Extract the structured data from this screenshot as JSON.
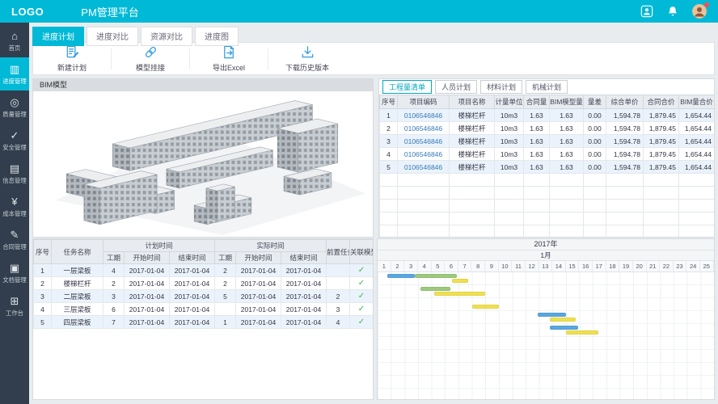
{
  "colors": {
    "accent": "#00b9d6",
    "sidebar_bg": "#323e4d",
    "bar_blue": "#5aa7e0",
    "bar_green": "#9dc97c",
    "bar_yellow": "#f0e04e",
    "check_green": "#3cb54a"
  },
  "header": {
    "logo": "LOGO",
    "title": "PM管理平台",
    "icons": [
      "contacts-icon",
      "notification-bell-icon",
      "user-avatar"
    ]
  },
  "sidebar": {
    "items": [
      {
        "label": "首页",
        "icon": "home",
        "active": false
      },
      {
        "label": "进度管理",
        "icon": "progress",
        "active": true
      },
      {
        "label": "质量管理",
        "icon": "quality",
        "active": false
      },
      {
        "label": "安全管理",
        "icon": "safety",
        "active": false
      },
      {
        "label": "信息管理",
        "icon": "info",
        "active": false
      },
      {
        "label": "成本管理",
        "icon": "cost",
        "active": false
      },
      {
        "label": "合同管理",
        "icon": "contract",
        "active": false
      },
      {
        "label": "文档管理",
        "icon": "docs",
        "active": false
      },
      {
        "label": "工作台",
        "icon": "workbench",
        "active": false
      }
    ]
  },
  "main_tabs": [
    {
      "label": "进度计划",
      "active": true
    },
    {
      "label": "进度对比",
      "active": false
    },
    {
      "label": "资源对比",
      "active": false
    },
    {
      "label": "进度图",
      "active": false
    }
  ],
  "toolbar": [
    {
      "label": "新建计划",
      "icon": "new-plan"
    },
    {
      "label": "模型挂接",
      "icon": "model-link"
    },
    {
      "label": "导出Excel",
      "icon": "export-excel"
    },
    {
      "label": "下载历史版本",
      "icon": "download-history"
    }
  ],
  "bim_panel": {
    "title": "BIM模型"
  },
  "boq_panel": {
    "tabs": [
      {
        "label": "工程量清单",
        "active": true
      },
      {
        "label": "人员计划",
        "active": false
      },
      {
        "label": "材料计划",
        "active": false
      },
      {
        "label": "机械计划",
        "active": false
      }
    ],
    "columns": [
      "序号",
      "项目编码",
      "项目名称",
      "计量单位",
      "合同量",
      "BIM模型量",
      "量差",
      "综合单价",
      "合同合价",
      "BIM量合价"
    ],
    "rows": [
      [
        "1",
        "0106546846",
        "楼梯栏杆",
        "10m3",
        "1.63",
        "1.63",
        "0.00",
        "1,594.78",
        "1,879.45",
        "1,654.44"
      ],
      [
        "2",
        "0106546846",
        "楼梯栏杆",
        "10m3",
        "1.63",
        "1.63",
        "0.00",
        "1,594.78",
        "1,879.45",
        "1,654.44"
      ],
      [
        "3",
        "0106546846",
        "楼梯栏杆",
        "10m3",
        "1.63",
        "1.63",
        "0.00",
        "1,594.78",
        "1,879.45",
        "1,654.44"
      ],
      [
        "4",
        "0106546846",
        "楼梯栏杆",
        "10m3",
        "1.63",
        "1.63",
        "0.00",
        "1,594.78",
        "1,879.45",
        "1,654.44"
      ],
      [
        "5",
        "0106546846",
        "楼梯栏杆",
        "10m3",
        "1.63",
        "1.63",
        "0.00",
        "1,594.78",
        "1,879.45",
        "1,654.44"
      ]
    ]
  },
  "task_table": {
    "col_no": "序号",
    "col_name": "任务名称",
    "group_plan": "计划时间",
    "group_actual": "实际时间",
    "col_dur": "工期",
    "col_start": "开始时间",
    "col_end": "结束时间",
    "col_pre": "前置任务",
    "col_model": "关联模型",
    "rows": [
      {
        "no": "1",
        "name": "一层梁板",
        "plan_dur": "4",
        "plan_start": "2017-01-04",
        "plan_end": "2017-01-04",
        "actual_dur": "2",
        "actual_start": "2017-01-04",
        "actual_end": "2017-01-04",
        "pre": "",
        "linked": "✓"
      },
      {
        "no": "2",
        "name": "楼梯栏杆",
        "plan_dur": "2",
        "plan_start": "2017-01-04",
        "plan_end": "2017-01-04",
        "actual_dur": "2",
        "actual_start": "2017-01-04",
        "actual_end": "2017-01-04",
        "pre": "",
        "linked": "✓"
      },
      {
        "no": "3",
        "name": "二层梁板",
        "plan_dur": "3",
        "plan_start": "2017-01-04",
        "plan_end": "2017-01-04",
        "actual_dur": "5",
        "actual_start": "2017-01-04",
        "actual_end": "2017-01-04",
        "pre": "2",
        "linked": "✓"
      },
      {
        "no": "4",
        "name": "三层梁板",
        "plan_dur": "6",
        "plan_start": "2017-01-04",
        "plan_end": "2017-01-04",
        "actual_dur": "",
        "actual_start": "2017-01-04",
        "actual_end": "2017-01-04",
        "pre": "3",
        "linked": "✓"
      },
      {
        "no": "5",
        "name": "四层梁板",
        "plan_dur": "7",
        "plan_start": "2017-01-04",
        "plan_end": "2017-01-04",
        "actual_dur": "1",
        "actual_start": "2017-01-04",
        "actual_end": "2017-01-04",
        "pre": "4",
        "linked": "✓"
      }
    ]
  },
  "gantt": {
    "year": "2017年",
    "month": "1月",
    "days": [
      "1",
      "2",
      "3",
      "4",
      "5",
      "6",
      "7",
      "8",
      "9",
      "10",
      "11",
      "12",
      "13",
      "14",
      "15",
      "16",
      "17",
      "18",
      "19",
      "20",
      "21",
      "22",
      "23",
      "24",
      "25"
    ],
    "bars": [
      {
        "row": 0,
        "lane": 0,
        "start": 0.7,
        "len": 2.05,
        "color": "blue"
      },
      {
        "row": 0,
        "lane": 0,
        "start": 2.75,
        "len": 3.15,
        "color": "green"
      },
      {
        "row": 0,
        "lane": 1,
        "start": 5.5,
        "len": 1.2,
        "color": "yellow"
      },
      {
        "row": 1,
        "lane": 0,
        "start": 3.2,
        "len": 2.2,
        "color": "green"
      },
      {
        "row": 1,
        "lane": 1,
        "start": 4.2,
        "len": 3.8,
        "color": "yellow"
      },
      {
        "row": 2,
        "lane": 1,
        "start": 7.0,
        "len": 2.0,
        "color": "yellow"
      },
      {
        "row": 3,
        "lane": 0,
        "start": 11.9,
        "len": 2.1,
        "color": "blue"
      },
      {
        "row": 3,
        "lane": 1,
        "start": 12.8,
        "len": 1.9,
        "color": "yellow"
      },
      {
        "row": 4,
        "lane": 0,
        "start": 12.8,
        "len": 2.1,
        "color": "blue"
      },
      {
        "row": 4,
        "lane": 1,
        "start": 14.0,
        "len": 2.4,
        "color": "yellow"
      }
    ]
  }
}
